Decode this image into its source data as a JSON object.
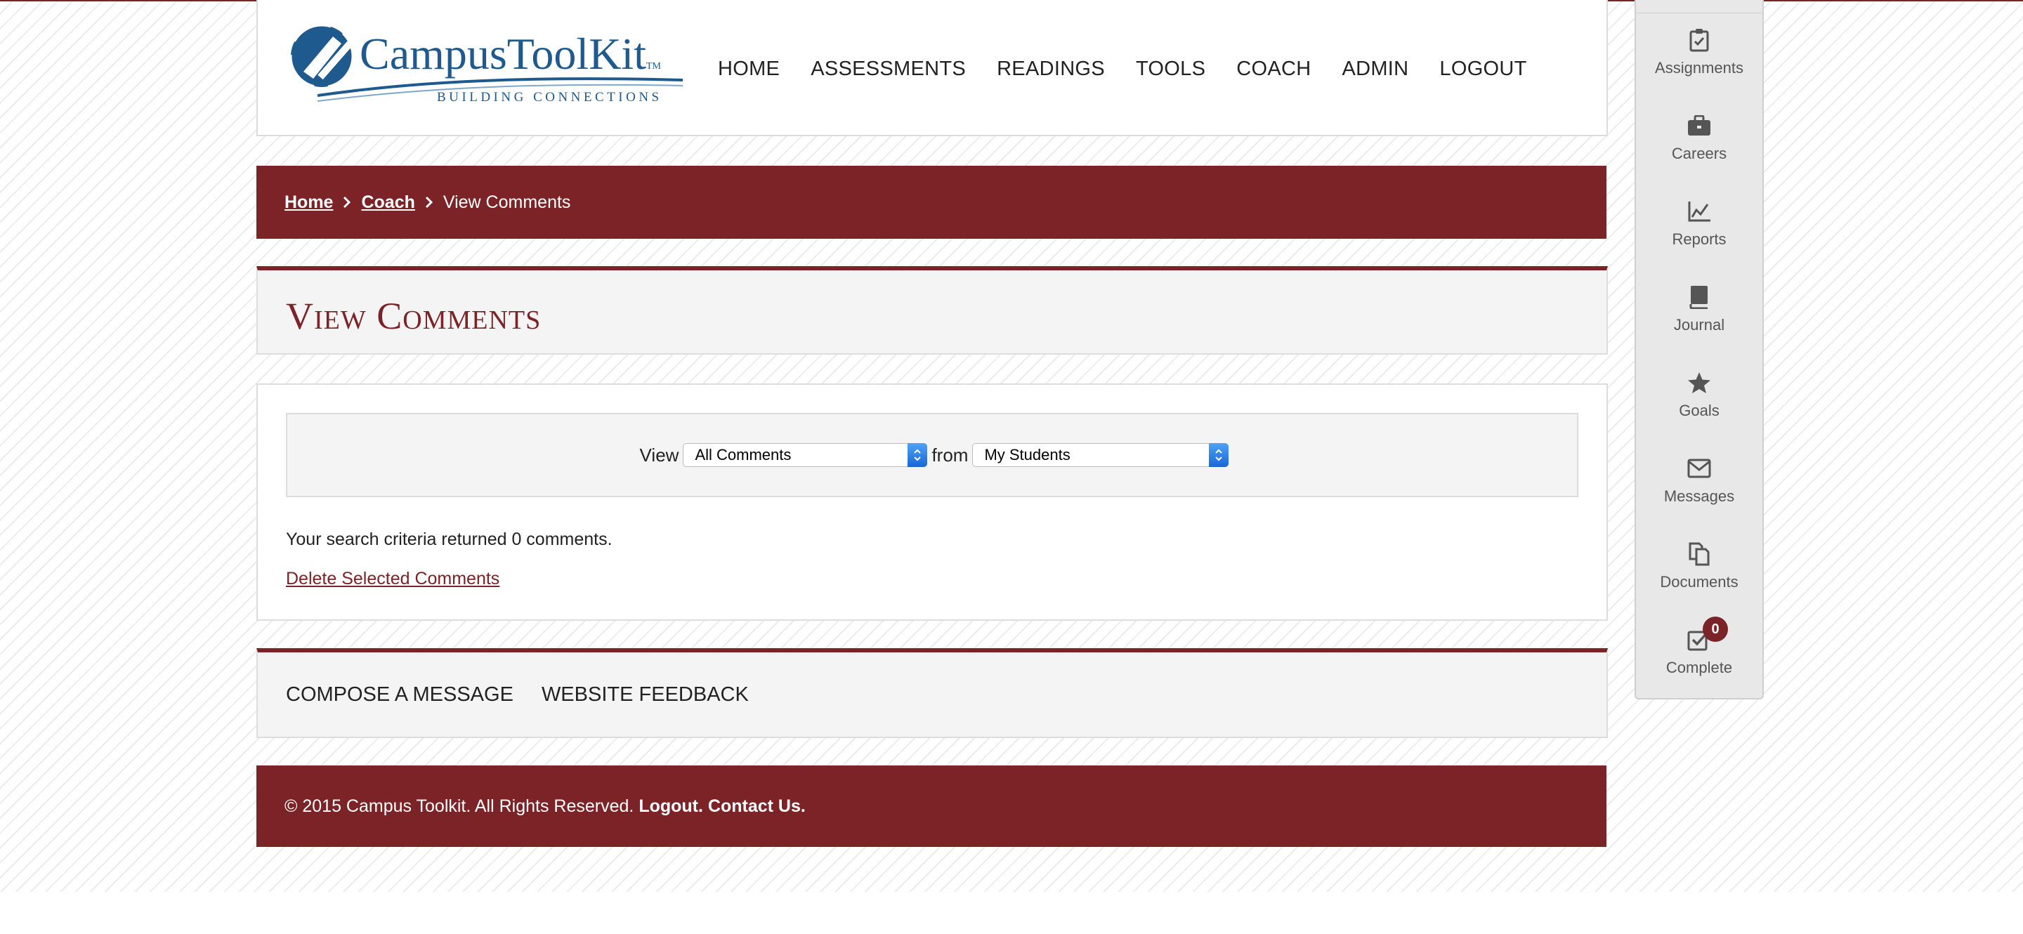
{
  "colors": {
    "brand": "#7b2326",
    "logo_blue": "#1f5a8e",
    "select_accent": "#2a7ae8"
  },
  "logo": {
    "name_prefix": "Campus",
    "name_suffix": "ToolKit",
    "trademark": "TM",
    "tagline": "BUILDING CONNECTIONS"
  },
  "nav": [
    {
      "label": "HOME"
    },
    {
      "label": "ASSESSMENTS"
    },
    {
      "label": "READINGS"
    },
    {
      "label": "TOOLS"
    },
    {
      "label": "COACH"
    },
    {
      "label": "ADMIN"
    },
    {
      "label": "LOGOUT"
    }
  ],
  "breadcrumb": {
    "home": "Home",
    "coach": "Coach",
    "current": "View Comments",
    "separator_icon": "chevron-right-icon"
  },
  "page": {
    "title": "View Comments"
  },
  "filter": {
    "view_label": "View",
    "view_selected": "All Comments",
    "from_label": "from",
    "from_selected": "My Students"
  },
  "results": {
    "text": "Your search criteria returned 0 comments.",
    "delete_link": "Delete Selected Comments"
  },
  "footer_links": {
    "compose": "COMPOSE A MESSAGE",
    "feedback": "WEBSITE FEEDBACK"
  },
  "footer": {
    "copyright": "© 2015 Campus Toolkit. All Rights Reserved.",
    "logout": "Logout.",
    "contact": "Contact Us."
  },
  "sidebar": {
    "items": [
      {
        "label": "Assignments",
        "icon": "clipboard-check-icon"
      },
      {
        "label": "Careers",
        "icon": "briefcase-icon"
      },
      {
        "label": "Reports",
        "icon": "line-chart-icon"
      },
      {
        "label": "Journal",
        "icon": "book-icon"
      },
      {
        "label": "Goals",
        "icon": "star-icon"
      },
      {
        "label": "Messages",
        "icon": "envelope-icon"
      },
      {
        "label": "Documents",
        "icon": "documents-icon"
      },
      {
        "label": "Complete",
        "icon": "checkbox-icon",
        "badge": "0"
      }
    ]
  }
}
